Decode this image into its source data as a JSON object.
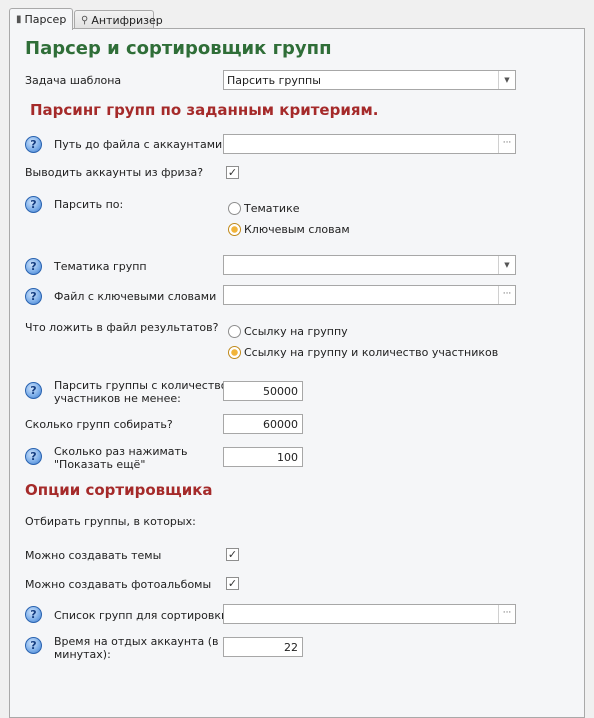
{
  "tabs": [
    {
      "label": "Парсер",
      "icon": "document-icon"
    },
    {
      "label": "Антифризер",
      "icon": "search-icon"
    }
  ],
  "title": "Парсер и сортировщик групп",
  "template_task": {
    "label": "Задача шаблона",
    "value": "Парсить группы"
  },
  "parse_section_title": "Парсинг групп по заданным критериям.",
  "accounts_file": {
    "label": "Путь до файла с аккаунтами",
    "value": ""
  },
  "freeze_out": {
    "label": "Выводить аккаунты из фриза?",
    "checked": true
  },
  "parse_by": {
    "label": "Парсить по:",
    "options": [
      "Тематике",
      "Ключевым словам"
    ],
    "selected": "Ключевым словам"
  },
  "group_topic": {
    "label": "Тематика групп",
    "value": ""
  },
  "keywords_file": {
    "label": "Файл с ключевыми словами",
    "value": ""
  },
  "result_file": {
    "label": "Что ложить в файл результатов?",
    "options": [
      "Ссылку на группу",
      "Ссылку на группу и количество участников"
    ],
    "selected": "Ссылку на группу и количество участников"
  },
  "min_members": {
    "label_line1": "Парсить группы с количеством",
    "label_line2": "участников не менее:",
    "value": "50000"
  },
  "groups_count": {
    "label": "Сколько групп собирать?",
    "value": "60000"
  },
  "show_more": {
    "label_line1": "Сколько раз нажимать",
    "label_line2": "\"Показать ещё\"",
    "value": "100"
  },
  "sort_section_title": "Опции сортировщика",
  "select_groups_label": "Отбирать группы, в которых:",
  "can_topics": {
    "label": "Можно создавать темы",
    "checked": true
  },
  "can_albums": {
    "label": "Можно создавать фотоальбомы",
    "checked": true
  },
  "sort_list": {
    "label": "Список групп для сортировки",
    "value": ""
  },
  "rest_time": {
    "label_line1": "Время на отдых аккаунта (в",
    "label_line2": "минутах):",
    "value": "22"
  },
  "glyphs": {
    "help": "?",
    "check": "✓",
    "ellipsis": "···",
    "dropdown": "▼"
  }
}
